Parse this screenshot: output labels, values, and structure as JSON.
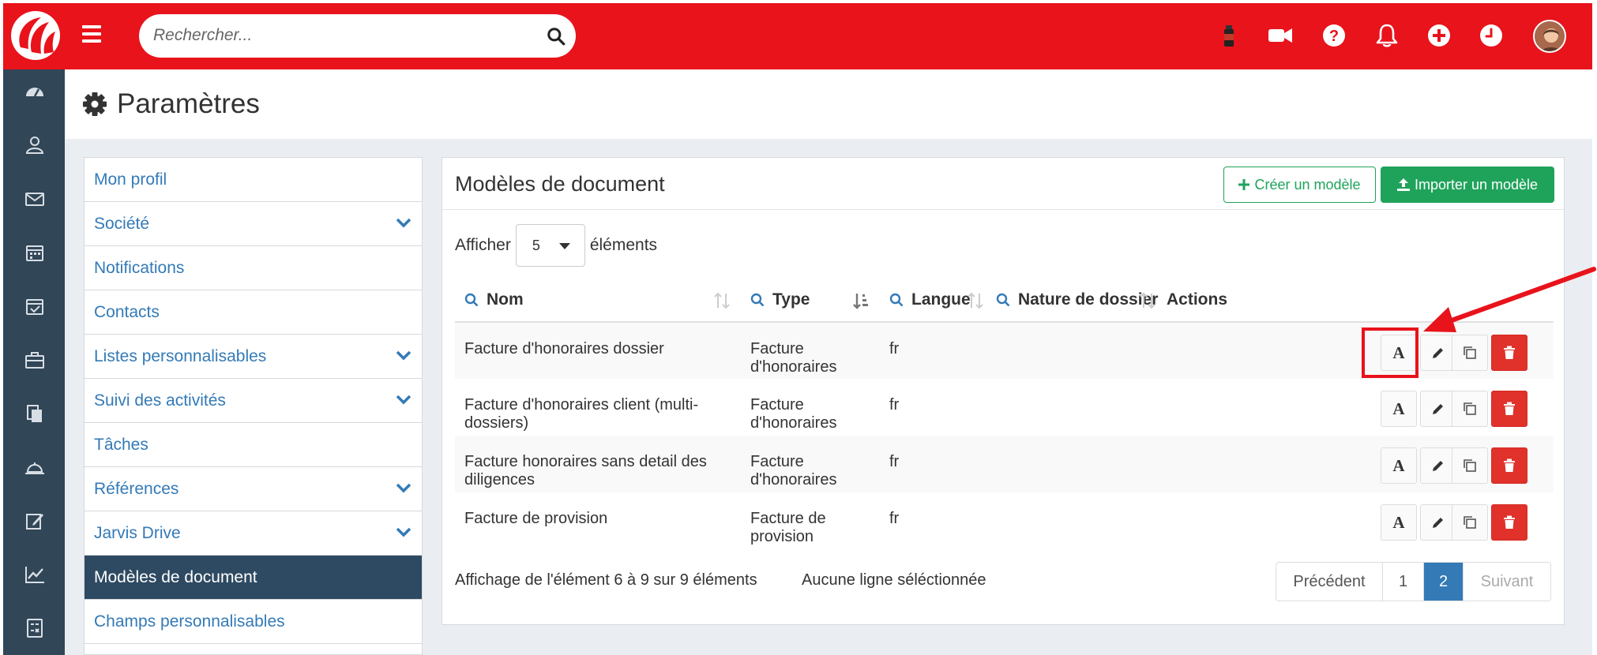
{
  "topbar": {
    "search_placeholder": "Rechercher...",
    "icons": [
      "bottle-icon",
      "video-camera-icon",
      "help-icon",
      "bell-icon",
      "plus-circle-icon",
      "clock-icon"
    ],
    "colors": {
      "brand": "#e8131b",
      "sidebar": "#314657",
      "green": "#1fa35b",
      "active_page": "#337ab7",
      "delete": "#e0312b"
    }
  },
  "sidebar": {
    "icons": [
      "dashboard-icon",
      "contacts-icon",
      "mail-icon",
      "calendar-icon",
      "calendar-check-icon",
      "briefcase-icon",
      "documents-icon",
      "reception-bell-icon",
      "edit-icon",
      "chart-icon",
      "calculator-icon"
    ]
  },
  "page": {
    "title": "Paramètres"
  },
  "menu": {
    "items": [
      {
        "label": "Mon profil"
      },
      {
        "label": "Société"
      },
      {
        "label": "Notifications"
      },
      {
        "label": "Contacts"
      },
      {
        "label": "Listes personnalisables"
      },
      {
        "label": "Suivi des activités"
      },
      {
        "label": "Tâches"
      },
      {
        "label": "Références"
      },
      {
        "label": "Jarvis Drive"
      },
      {
        "label": "Modèles de document"
      },
      {
        "label": "Champs personnalisables"
      }
    ]
  },
  "panel": {
    "title": "Modèles de document",
    "create_label": "Créer un modèle",
    "import_label": "Importer un modèle",
    "show_label": "Afficher",
    "length_value": "5",
    "elements_label": "éléments",
    "columns": [
      "Nom",
      "Type",
      "Langue",
      "Nature de dossier",
      "Actions"
    ],
    "rows": [
      {
        "name": "Facture d'honoraires dossier",
        "type": "Facture d'honoraires",
        "lang": "fr",
        "nature": ""
      },
      {
        "name": "Facture d'honoraires client (multi-dossiers)",
        "type": "Facture d'honoraires",
        "lang": "fr",
        "nature": ""
      },
      {
        "name": "Facture honoraires sans detail des diligences",
        "type": "Facture d'honoraires",
        "lang": "fr",
        "nature": ""
      },
      {
        "name": "Facture de provision",
        "type": "Facture de provision",
        "lang": "fr",
        "nature": ""
      }
    ],
    "font_button_glyph": "A",
    "info": "Affichage de l'élément 6 à 9 sur 9 éléments",
    "selection": "Aucune ligne séléctionnée",
    "pager": {
      "prev": "Précédent",
      "p1": "1",
      "p2": "2",
      "next": "Suivant"
    }
  }
}
